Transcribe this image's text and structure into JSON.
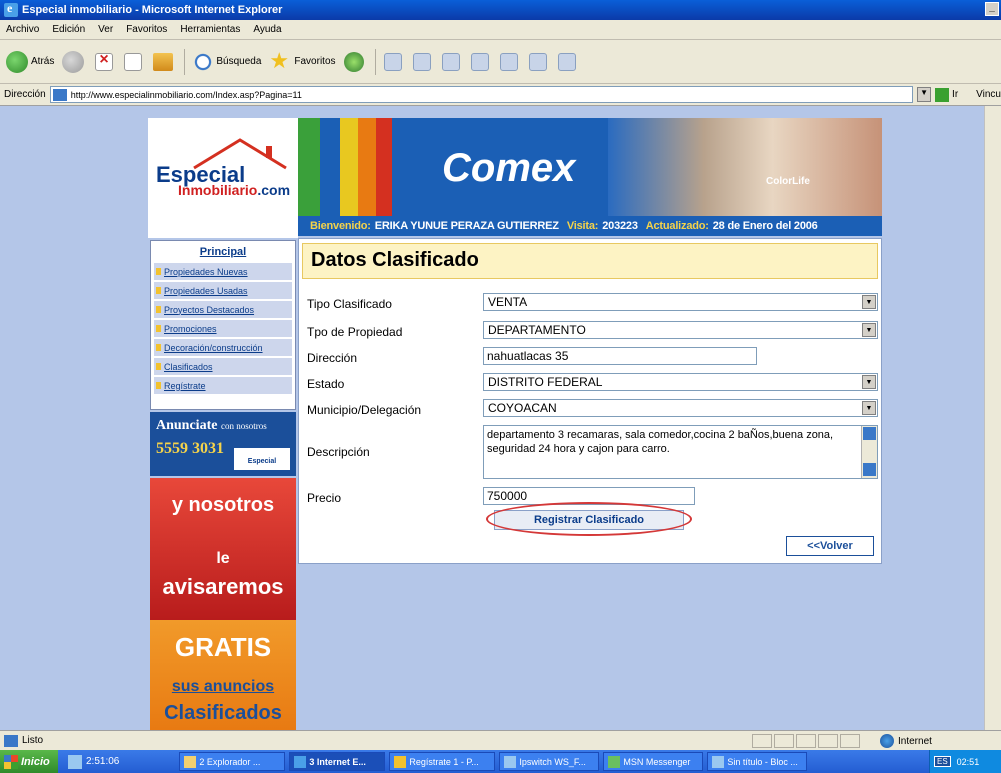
{
  "window": {
    "title": "Especial inmobiliario - Microsoft Internet Explorer"
  },
  "menu": [
    "Archivo",
    "Edición",
    "Ver",
    "Favoritos",
    "Herramientas",
    "Ayuda"
  ],
  "toolbar": {
    "back": "Atrás",
    "search": "Búsqueda",
    "favorites": "Favoritos"
  },
  "address": {
    "label": "Dirección",
    "url": "http://www.especialinmobiliario.com/Index.asp?Pagina=11",
    "go": "Ir",
    "links": "Vincu"
  },
  "site": {
    "logo_line1": "Especial",
    "logo_line2": "Inmobiliario",
    "logo_domain": ".com",
    "banner_brand": "Comex",
    "banner_sub": "ColorLife",
    "welcome_label": "Bienvenido:",
    "welcome_user": "ERIKA YUNUE PERAZA GUTIERREZ",
    "visits_label": "Visita:",
    "visits_value": "203223",
    "updated_label": "Actualizado:",
    "updated_value": "28 de Enero del 2006"
  },
  "sidebar": {
    "title": "Principal",
    "items": [
      {
        "label": "Propiedades Nuevas"
      },
      {
        "label": "Propiedades Usadas"
      },
      {
        "label": "Proyectos Destacados"
      },
      {
        "label": "Promociones"
      },
      {
        "label": "Decoración/construcción"
      },
      {
        "label": "Clasificados"
      },
      {
        "label": "Regístrate"
      }
    ]
  },
  "ads": {
    "anunciate": "Anunciate",
    "con_nosotros": "con nosotros",
    "phone": "5559 3031",
    "mini_logo": "Especial",
    "red_1": "y nosotros",
    "red_2": "le",
    "red_3": "avisaremos",
    "orange_1": "GRATIS",
    "orange_2": "sus anuncios",
    "orange_3": "Clasificados"
  },
  "form": {
    "title": "Datos Clasificado",
    "fields": {
      "tipo_clasificado": {
        "label": "Tipo Clasificado",
        "value": "VENTA"
      },
      "tipo_propiedad": {
        "label": "Tpo de Propiedad",
        "value": "DEPARTAMENTO"
      },
      "direccion": {
        "label": "Dirección",
        "value": "nahuatlacas 35"
      },
      "estado": {
        "label": "Estado",
        "value": "DISTRITO FEDERAL"
      },
      "municipio": {
        "label": "Municipio/Delegación",
        "value": "COYOACAN"
      },
      "descripcion": {
        "label": "Descripción",
        "value": "departamento 3 recamaras, sala comedor,cocina 2 baÑos,buena zona, seguridad 24 hora y cajon para carro."
      },
      "precio": {
        "label": "Precio",
        "value": "750000"
      }
    },
    "submit_label": "Registrar Clasificado",
    "back_label": "<<Volver"
  },
  "status": {
    "text": "Listo",
    "zone": "Internet"
  },
  "taskbar": {
    "start": "Inicio",
    "clock_left": "2:51:06",
    "tasks": [
      {
        "label": "2 Explorador ..."
      },
      {
        "label": "3 Internet E..."
      },
      {
        "label": "Regístrate 1 - P..."
      },
      {
        "label": "Ipswitch WS_F..."
      },
      {
        "label": "MSN Messenger"
      },
      {
        "label": "Sin título - Bloc ..."
      }
    ],
    "lang": "ES",
    "clock": "02:51"
  }
}
